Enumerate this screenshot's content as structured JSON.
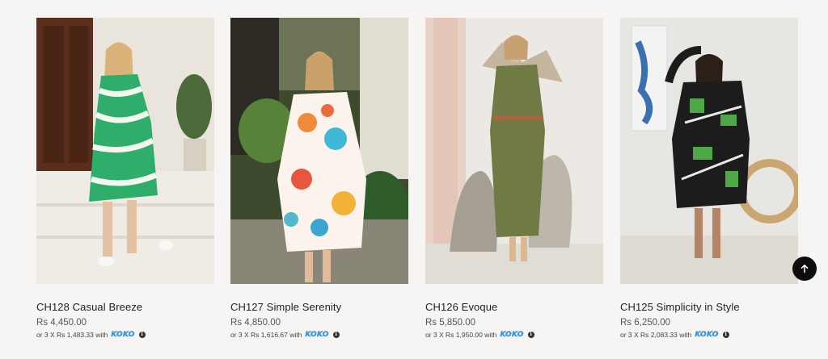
{
  "products": [
    {
      "title": "CH128 Casual Breeze",
      "price": "Rs 4,450.00",
      "installment": "or 3 X Rs 1,483.33 with",
      "image_alt": "Model in green and white swirl print shirt dress"
    },
    {
      "title": "CH127 Simple Serenity",
      "price": "Rs 4,850.00",
      "installment": "or 3 X Rs 1,616.67 with",
      "image_alt": "Model in multicolour floral print shirt dress"
    },
    {
      "title": "CH126 Evoque",
      "price": "Rs 5,850.00",
      "installment": "or 3 X Rs 1,950.00 with",
      "image_alt": "Model in olive green belted dress"
    },
    {
      "title": "CH125 Simplicity in Style",
      "price": "Rs 6,250.00",
      "installment": "or 3 X Rs 2,083.33 with",
      "image_alt": "Model in black and green geometric print shirt dress"
    }
  ],
  "payment_brand": "KOKO",
  "info_symbol": "i",
  "icons": {
    "info": "info-icon",
    "back_to_top": "arrow-up-icon"
  },
  "colors": {
    "background": "#f6f5f3",
    "koko": "#3ba0e6",
    "back_to_top": "#0d0d0d"
  }
}
